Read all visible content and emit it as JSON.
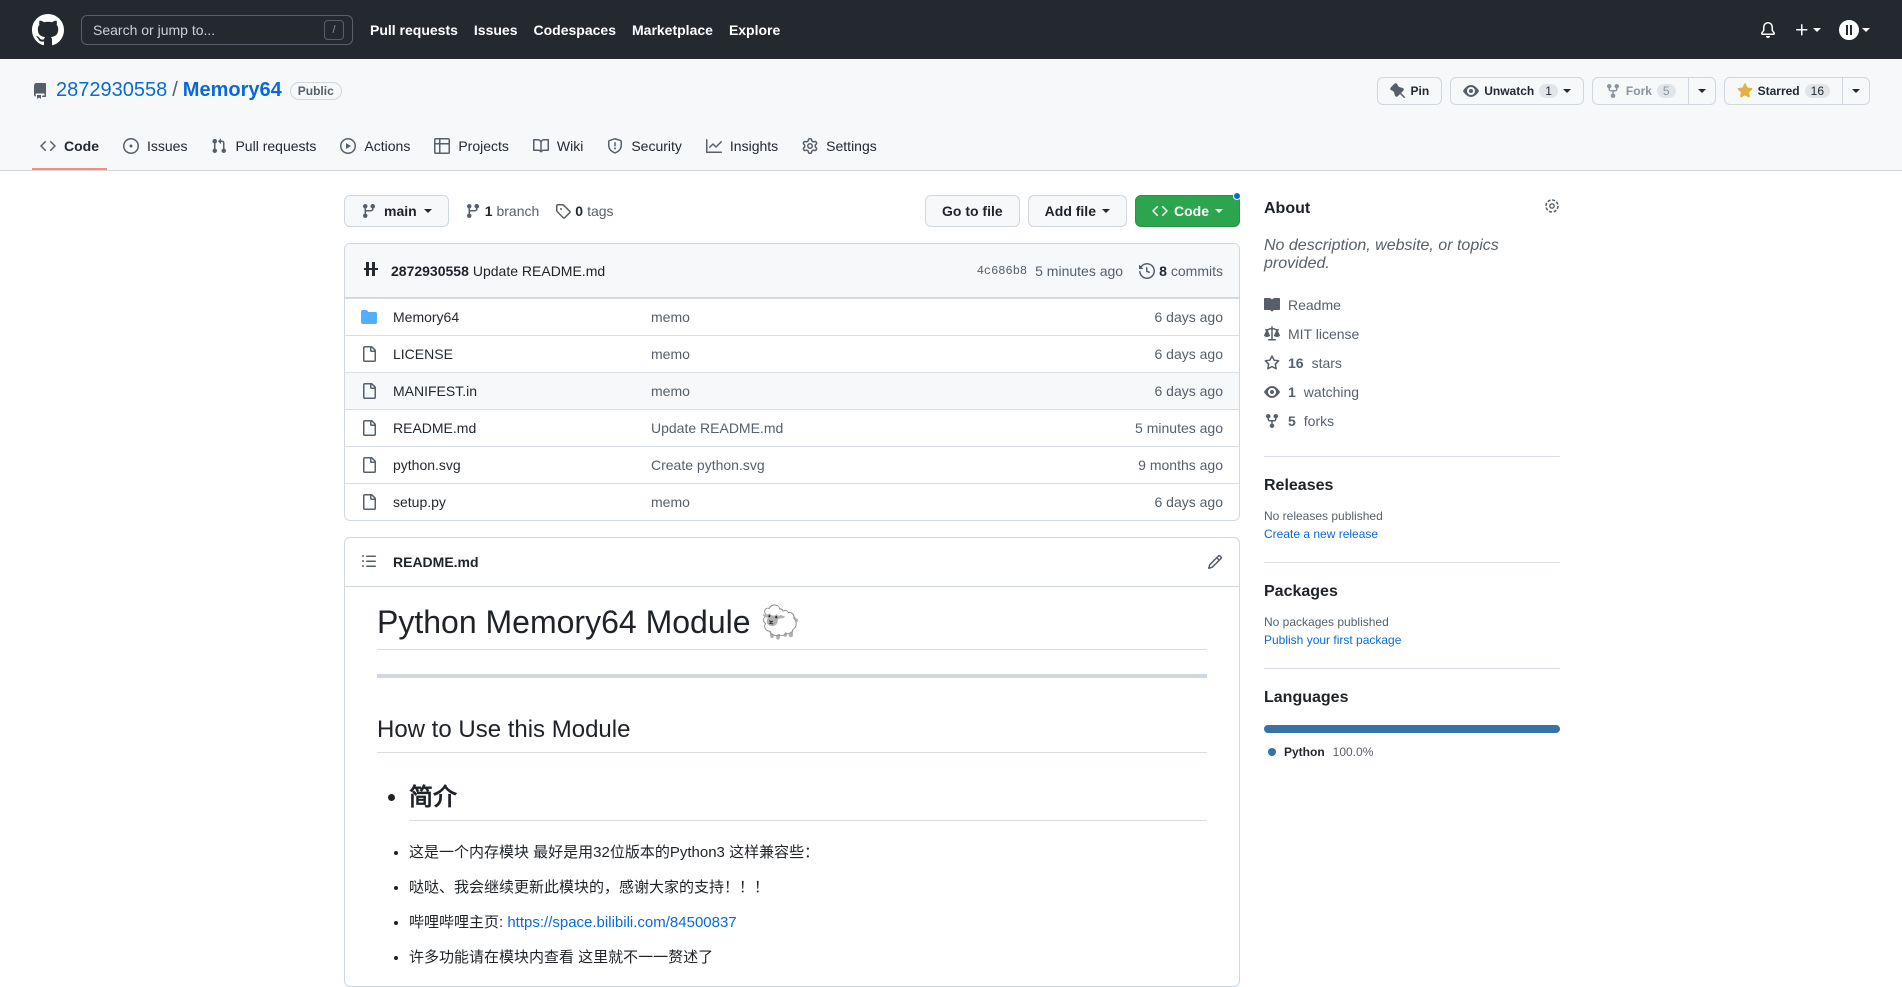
{
  "header": {
    "search_placeholder": "Search or jump to...",
    "search_shortcut": "/",
    "nav": [
      "Pull requests",
      "Issues",
      "Codespaces",
      "Marketplace",
      "Explore"
    ]
  },
  "repo": {
    "owner": "2872930558",
    "separator": "/",
    "name": "Memory64",
    "visibility": "Public",
    "pin_label": "Pin",
    "unwatch_label": "Unwatch",
    "watch_count": "1",
    "fork_label": "Fork",
    "fork_count": "5",
    "starred_label": "Starred",
    "star_count": "16",
    "tabs": [
      "Code",
      "Issues",
      "Pull requests",
      "Actions",
      "Projects",
      "Wiki",
      "Security",
      "Insights",
      "Settings"
    ]
  },
  "filenav": {
    "branch": "main",
    "branch_count": "1",
    "branch_word": "branch",
    "tag_count": "0",
    "tag_word": "tags",
    "go_to_file": "Go to file",
    "add_file": "Add file",
    "code": "Code"
  },
  "commit": {
    "author": "2872930558",
    "message": "Update README.md",
    "sha": "4c686b8",
    "time": "5 minutes ago",
    "commit_count": "8",
    "commit_word": "commits"
  },
  "files": [
    {
      "name": "Memory64",
      "type": "dir",
      "message": "memo",
      "age": "6 days ago"
    },
    {
      "name": "LICENSE",
      "type": "file",
      "message": "memo",
      "age": "6 days ago"
    },
    {
      "name": "MANIFEST.in",
      "type": "file",
      "message": "memo",
      "age": "6 days ago"
    },
    {
      "name": "README.md",
      "type": "file",
      "message": "Update README.md",
      "age": "5 minutes ago"
    },
    {
      "name": "python.svg",
      "type": "file",
      "message": "Create python.svg",
      "age": "9 months ago"
    },
    {
      "name": "setup.py",
      "type": "file",
      "message": "memo",
      "age": "6 days ago"
    }
  ],
  "readme": {
    "filename": "README.md",
    "title": "Python Memory64 Module",
    "title_emoji": "🐑",
    "h2": "How to Use this Module",
    "intro_heading": "简介",
    "bullets": [
      "这是一个内存模块 最好是用32位版本的Python3 这样兼容些：",
      "哒哒、我会继续更新此模块的，感谢大家的支持！！！",
      "哔哩哔哩主页: ",
      "许多功能请在模块内查看 这里就不一一赘述了"
    ],
    "bilibili_link": "https://space.bilibili.com/84500837"
  },
  "sidebar": {
    "about_title": "About",
    "about_desc": "No description, website, or topics provided.",
    "readme": "Readme",
    "license": "MIT license",
    "stars_count": "16",
    "stars_word": "stars",
    "watching_count": "1",
    "watching_word": "watching",
    "forks_count": "5",
    "forks_word": "forks",
    "releases_title": "Releases",
    "releases_none": "No releases published",
    "releases_link": "Create a new release",
    "packages_title": "Packages",
    "packages_none": "No packages published",
    "packages_link": "Publish your first package",
    "languages_title": "Languages",
    "language_name": "Python",
    "language_pct": "100.0%"
  },
  "colors": {
    "header_bg": "#24292f",
    "accent_green": "#2da44e",
    "link": "#0969da",
    "python": "#3572a5",
    "tab_underline": "#fd8c73"
  }
}
